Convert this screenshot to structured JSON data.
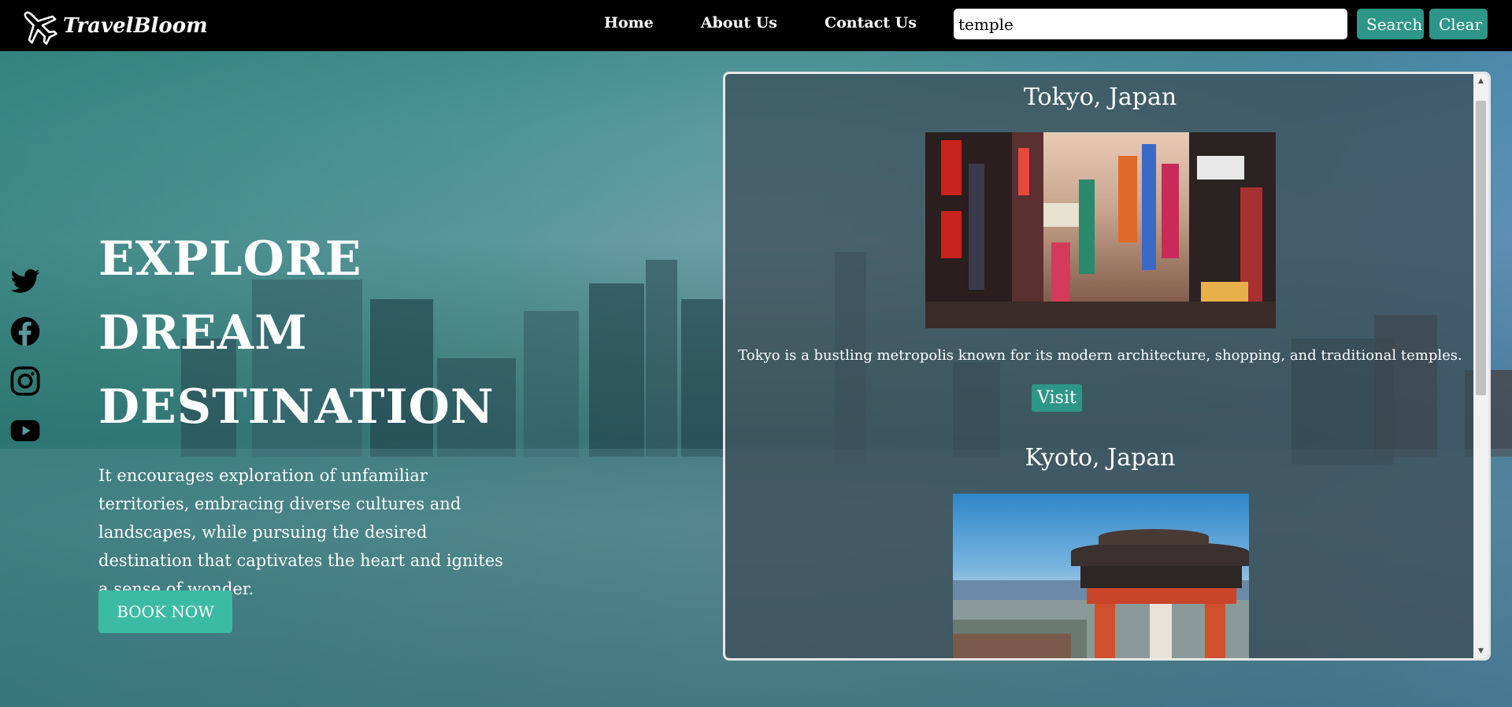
{
  "brand": {
    "name": "TravelBloom",
    "icon": "airplane-icon"
  },
  "nav": {
    "links": [
      "Home",
      "About Us",
      "Contact Us"
    ]
  },
  "search": {
    "value": "temple",
    "search_label": "Search",
    "clear_label": "Clear"
  },
  "social": {
    "icons": [
      "twitter-icon",
      "facebook-icon",
      "instagram-icon",
      "youtube-icon"
    ]
  },
  "hero": {
    "title_lines": [
      "EXPLORE",
      "DREAM",
      "DESTINATION"
    ],
    "text": "It encourages exploration of unfamiliar territories, embracing diverse cultures and landscapes, while pursuing the desired destination that captivates the heart and ignites a sense of wonder.",
    "book_label": "BOOK NOW"
  },
  "results": [
    {
      "title": "Tokyo, Japan",
      "description": "Tokyo is a bustling metropolis known for its modern architecture, shopping, and traditional temples.",
      "visit_label": "Visit"
    },
    {
      "title": "Kyoto, Japan"
    }
  ],
  "colors": {
    "accent": "#2e9688",
    "book_button": "#3bbba4",
    "navbar": "#000000"
  }
}
